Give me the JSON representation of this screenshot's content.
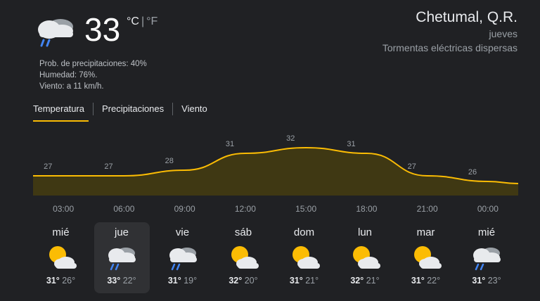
{
  "current": {
    "icon": "thunderstorm-icon",
    "temperature": "33",
    "unit_c": "°C",
    "unit_f": "°F",
    "precip": "Prob. de precipitaciones: 40%",
    "humidity": "Humedad: 76%.",
    "wind": "Viento: a 11 km/h."
  },
  "location": {
    "city": "Chetumal, Q.R.",
    "day": "jueves",
    "condition": "Tormentas eléctricas dispersas"
  },
  "tabs": [
    {
      "label": "Temperatura",
      "active": true
    },
    {
      "label": "Precipitaciones",
      "active": false
    },
    {
      "label": "Viento",
      "active": false
    }
  ],
  "chart_data": {
    "type": "area",
    "x": [
      "03:00",
      "06:00",
      "09:00",
      "12:00",
      "15:00",
      "18:00",
      "21:00",
      "00:00"
    ],
    "values": [
      27,
      27,
      28,
      31,
      32,
      31,
      27,
      26
    ],
    "color": "#fbbc04"
  },
  "days": [
    {
      "name": "mié",
      "icon": "partly-cloudy-icon",
      "high": "31°",
      "low": "26°",
      "selected": false
    },
    {
      "name": "jue",
      "icon": "thunderstorm-icon",
      "high": "33°",
      "low": "22°",
      "selected": true
    },
    {
      "name": "vie",
      "icon": "thunderstorm-icon",
      "high": "31°",
      "low": "19°",
      "selected": false
    },
    {
      "name": "sáb",
      "icon": "partly-cloudy-icon",
      "high": "32°",
      "low": "20°",
      "selected": false
    },
    {
      "name": "dom",
      "icon": "partly-cloudy-icon",
      "high": "31°",
      "low": "21°",
      "selected": false
    },
    {
      "name": "lun",
      "icon": "partly-cloudy-icon",
      "high": "32°",
      "low": "21°",
      "selected": false
    },
    {
      "name": "mar",
      "icon": "partly-cloudy-icon",
      "high": "31°",
      "low": "22°",
      "selected": false
    },
    {
      "name": "mié",
      "icon": "thunderstorm-icon",
      "high": "31°",
      "low": "23°",
      "selected": false
    }
  ],
  "colors": {
    "accent": "#fbbc04",
    "background": "#202124",
    "selected_card": "#303134"
  }
}
